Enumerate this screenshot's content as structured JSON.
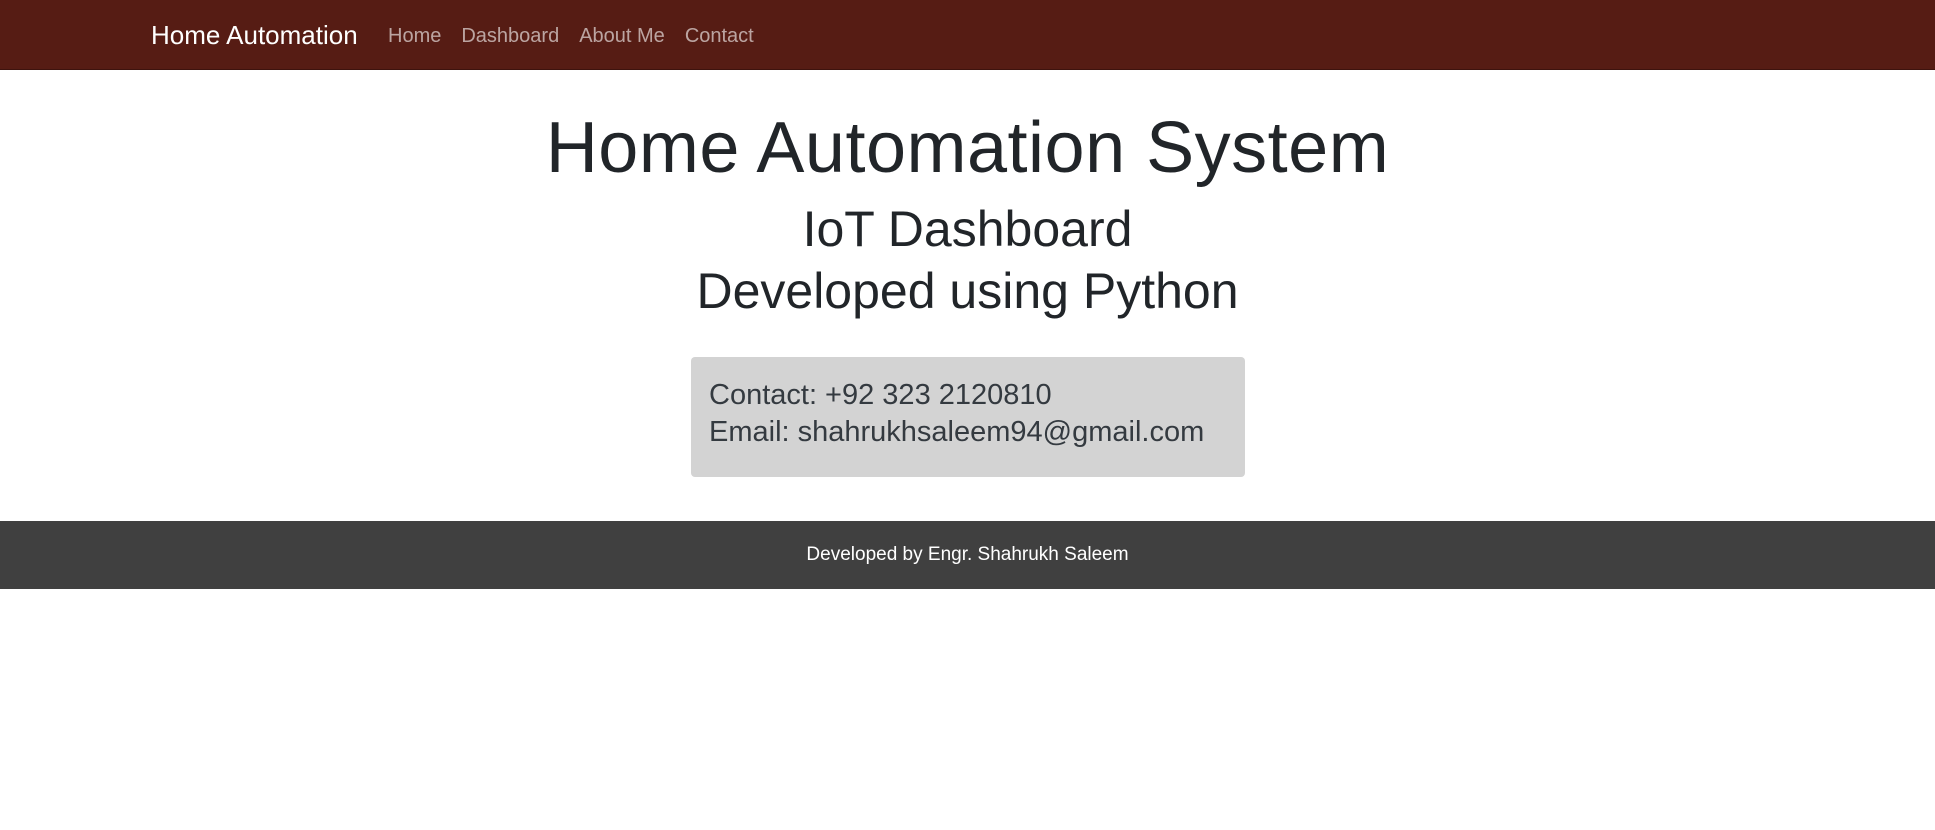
{
  "navbar": {
    "brand": "Home Automation",
    "links": [
      "Home",
      "Dashboard",
      "About Me",
      "Contact"
    ],
    "background_color": "#561c14"
  },
  "hero": {
    "title": "Home Automation System",
    "subtitle_1": "IoT Dashboard",
    "subtitle_2": "Developed using Python"
  },
  "contact_box": {
    "phone_line": "Contact: +92 323 2120810",
    "email_line": "Email: shahrukhsaleem94@gmail.com",
    "background_color": "#d3d3d3"
  },
  "footer": {
    "text": "Developed by Engr. Shahrukh Saleem",
    "background_color": "#404040"
  }
}
